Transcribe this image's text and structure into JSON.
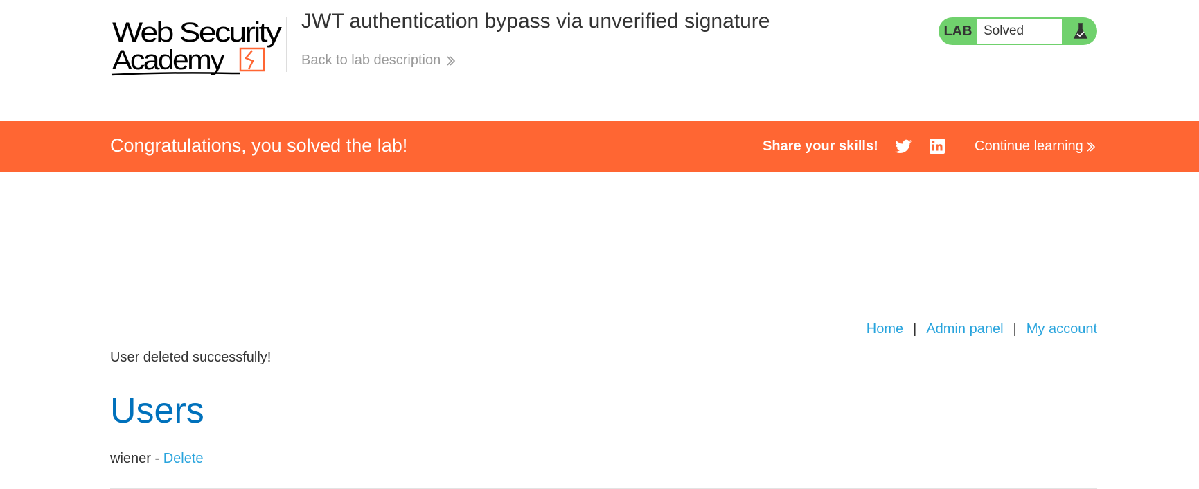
{
  "header": {
    "logo_text": "Web Security Academy",
    "title": "JWT authentication bypass via unverified signature",
    "back_link": "Back to lab description"
  },
  "status": {
    "lab_label": "LAB",
    "status_text": "Solved",
    "color": "#70d16d"
  },
  "banner": {
    "message": "Congratulations, you solved the lab!",
    "share_label": "Share your skills!",
    "continue_label": "Continue learning",
    "color": "#ff6633",
    "icons": [
      "twitter-icon",
      "linkedin-icon"
    ]
  },
  "nav": {
    "home": "Home",
    "admin_panel": "Admin panel",
    "my_account": "My account",
    "separator": "|"
  },
  "main": {
    "message": "User deleted successfully!",
    "heading": "Users",
    "users": [
      {
        "name": "wiener",
        "dash": " - ",
        "action": "Delete"
      }
    ]
  }
}
